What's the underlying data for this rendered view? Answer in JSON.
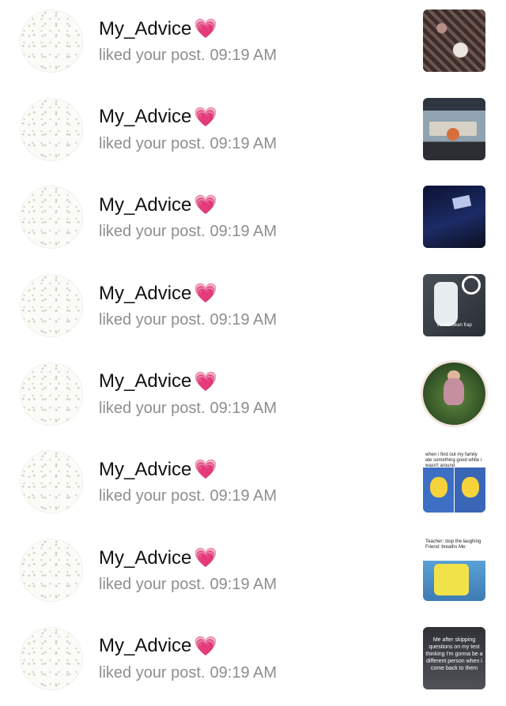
{
  "notifications": [
    {
      "username": "My_Advice",
      "heart": "💗",
      "action": "liked your post.",
      "time": "09:19 AM",
      "thumbnail_caption": ""
    },
    {
      "username": "My_Advice",
      "heart": "💗",
      "action": "liked your post.",
      "time": "09:19 AM",
      "thumbnail_caption": ""
    },
    {
      "username": "My_Advice",
      "heart": "💗",
      "action": "liked your post.",
      "time": "09:19 AM",
      "thumbnail_caption": ""
    },
    {
      "username": "My_Advice",
      "heart": "💗",
      "action": "liked your post.",
      "time": "09:19 AM",
      "thumbnail_caption": "Vanilla bean frap"
    },
    {
      "username": "My_Advice",
      "heart": "💗",
      "action": "liked your post.",
      "time": "09:19 AM",
      "thumbnail_caption": ""
    },
    {
      "username": "My_Advice",
      "heart": "💗",
      "action": "liked your post.",
      "time": "09:19 AM",
      "thumbnail_caption": "when i find out my family ate something good while i wasn't around"
    },
    {
      "username": "My_Advice",
      "heart": "💗",
      "action": "liked your post.",
      "time": "09:19 AM",
      "thumbnail_caption": "Teacher: stop the laughing Friend: breaths Me:"
    },
    {
      "username": "My_Advice",
      "heart": "💗",
      "action": "liked your post.",
      "time": "09:19 AM",
      "thumbnail_caption": "Me after skipping questions on my test thinking I'm gonna be a different person when i come back to them"
    }
  ]
}
